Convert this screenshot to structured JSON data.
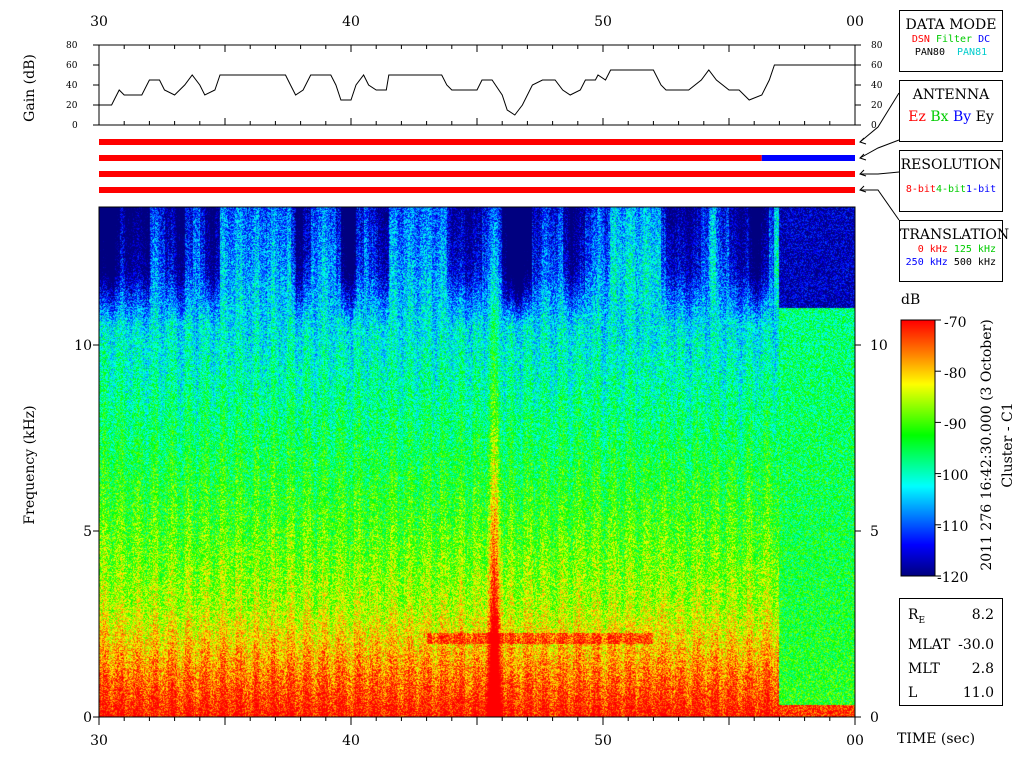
{
  "time_axis": {
    "top_ticks": [
      "30",
      "40",
      "50",
      "00"
    ],
    "bottom_ticks": [
      "30",
      "40",
      "50",
      "00"
    ],
    "label": "TIME (sec)"
  },
  "gain_panel": {
    "ylabel": "Gain (dB)",
    "ticks": [
      "80",
      "60",
      "40",
      "20",
      "0"
    ]
  },
  "spectrogram": {
    "ylabel": "Frequency (kHz)",
    "ticks": [
      "10",
      "5",
      "0"
    ]
  },
  "colorbar": {
    "unit": "dB",
    "ticks": [
      "-70",
      "-80",
      "-90",
      "-100",
      "-110",
      "-120"
    ],
    "side_title": "2011 276 16:42:30.000 (3 October)",
    "side_subtitle": "Cluster - C1"
  },
  "legend": {
    "data_mode": {
      "title": "DATA MODE",
      "row1": [
        {
          "text": "DSN",
          "color": "#ff0000"
        },
        {
          "text": "Filter",
          "color": "#00cc00"
        },
        {
          "text": "DC",
          "color": "#0000ff"
        }
      ],
      "row2": [
        {
          "text": "PAN80",
          "color": "#000000"
        },
        {
          "text": "PAN81",
          "color": "#00cccc"
        }
      ]
    },
    "antenna": {
      "title": "ANTENNA",
      "items": [
        {
          "text": "Ez",
          "color": "#ff0000"
        },
        {
          "text": "Bx",
          "color": "#00cc00"
        },
        {
          "text": "By",
          "color": "#0000ff"
        },
        {
          "text": "Ey",
          "color": "#000000"
        }
      ]
    },
    "resolution": {
      "title": "RESOLUTION",
      "items": [
        {
          "text": "8-bit",
          "color": "#ff0000"
        },
        {
          "text": "4-bit",
          "color": "#00cc00"
        },
        {
          "text": "1-bit",
          "color": "#0000ff"
        }
      ]
    },
    "translation": {
      "title": "TRANSLATION",
      "row1": [
        {
          "text": "0 kHz",
          "color": "#ff0000"
        },
        {
          "text": "125 kHz",
          "color": "#00cc00"
        }
      ],
      "row2": [
        {
          "text": "250 kHz",
          "color": "#0000ff"
        },
        {
          "text": "500 kHz",
          "color": "#000000"
        }
      ]
    }
  },
  "orbit_info": {
    "rows": [
      {
        "label": "R",
        "sub": "E",
        "value": "8.2"
      },
      {
        "label": "MLAT",
        "sub": "",
        "value": "-30.0"
      },
      {
        "label": "MLT",
        "sub": "",
        "value": "2.8"
      },
      {
        "label": "L",
        "sub": "",
        "value": "11.0"
      }
    ]
  },
  "chart_data": {
    "type": "heatmap",
    "x_range": [
      30,
      60
    ],
    "x_tick_labels": [
      "30",
      "40",
      "50",
      "00"
    ],
    "y_range_khz": [
      0,
      13.7
    ],
    "color_range_db": [
      -120,
      -70
    ],
    "colormap": [
      "#000080",
      "#0000ff",
      "#00ffff",
      "#00ff00",
      "#ffff00",
      "#ff8000",
      "#ff0000"
    ],
    "gain_trace": {
      "ylim": [
        0,
        80
      ],
      "points": [
        [
          30,
          20
        ],
        [
          30.5,
          20
        ],
        [
          30.6,
          25
        ],
        [
          30.8,
          35
        ],
        [
          31,
          30
        ],
        [
          31.7,
          30
        ],
        [
          32,
          45
        ],
        [
          32.4,
          45
        ],
        [
          32.6,
          35
        ],
        [
          33,
          30
        ],
        [
          33.4,
          40
        ],
        [
          33.7,
          50
        ],
        [
          34,
          40
        ],
        [
          34.2,
          30
        ],
        [
          34.6,
          35
        ],
        [
          34.8,
          50
        ],
        [
          37.4,
          50
        ],
        [
          37.6,
          40
        ],
        [
          37.8,
          30
        ],
        [
          38.1,
          35
        ],
        [
          38.4,
          50
        ],
        [
          39.2,
          50
        ],
        [
          39.4,
          40
        ],
        [
          39.6,
          25
        ],
        [
          40,
          25
        ],
        [
          40.2,
          40
        ],
        [
          40.5,
          50
        ],
        [
          40.7,
          40
        ],
        [
          41,
          35
        ],
        [
          41.4,
          35
        ],
        [
          41.5,
          50
        ],
        [
          43.6,
          50
        ],
        [
          43.8,
          40
        ],
        [
          44,
          35
        ],
        [
          45,
          35
        ],
        [
          45.2,
          45
        ],
        [
          45.6,
          45
        ],
        [
          46,
          30
        ],
        [
          46.2,
          15
        ],
        [
          46.5,
          10
        ],
        [
          46.8,
          20
        ],
        [
          47.2,
          40
        ],
        [
          47.6,
          45
        ],
        [
          48.1,
          45
        ],
        [
          48.4,
          35
        ],
        [
          48.7,
          30
        ],
        [
          49.1,
          35
        ],
        [
          49.3,
          45
        ],
        [
          49.7,
          45
        ],
        [
          49.8,
          50
        ],
        [
          50.1,
          45
        ],
        [
          50.3,
          55
        ],
        [
          52,
          55
        ],
        [
          52.3,
          40
        ],
        [
          52.5,
          35
        ],
        [
          53.4,
          35
        ],
        [
          53.9,
          45
        ],
        [
          54.2,
          55
        ],
        [
          54.5,
          45
        ],
        [
          55,
          35
        ],
        [
          55.4,
          35
        ],
        [
          55.8,
          25
        ],
        [
          56.3,
          30
        ],
        [
          56.6,
          45
        ],
        [
          56.8,
          60
        ],
        [
          60,
          60
        ]
      ]
    },
    "status_bars": [
      {
        "segments": [
          {
            "from": 30,
            "to": 60,
            "color": "#ff0000"
          }
        ]
      },
      {
        "segments": [
          {
            "from": 30,
            "to": 56.3,
            "color": "#ff0000"
          },
          {
            "from": 56.3,
            "to": 60,
            "color": "#0000ff"
          }
        ]
      },
      {
        "segments": [
          {
            "from": 30,
            "to": 60,
            "color": "#ff0000"
          }
        ]
      },
      {
        "segments": [
          {
            "from": 30,
            "to": 60,
            "color": "#ff0000"
          }
        ]
      }
    ],
    "features": {
      "low_freq_intense_band_khz": [
        0,
        3
      ],
      "narrowband_emission_khz": 2.1,
      "broadband_burst_time": 45.7,
      "low_gain_dark_region_start": 57
    }
  }
}
